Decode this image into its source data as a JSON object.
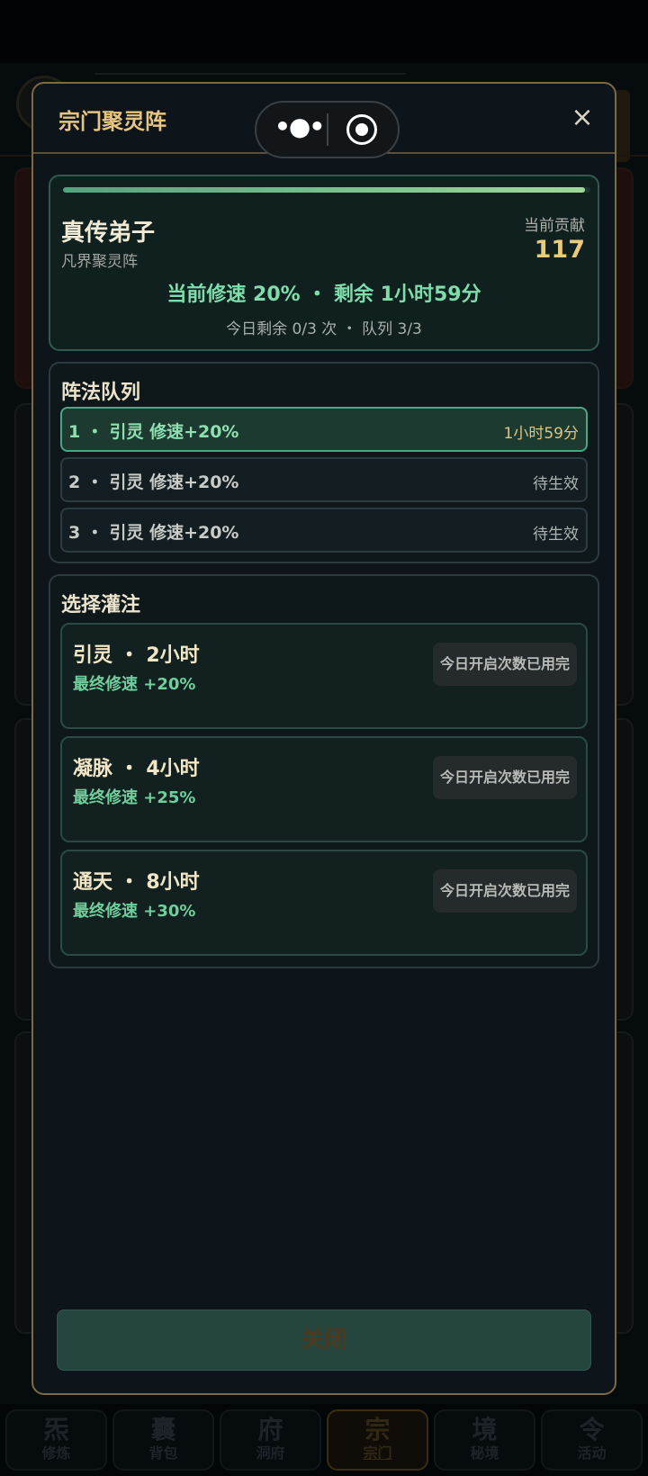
{
  "modal": {
    "title": "宗门聚灵阵",
    "close_icon": "×",
    "status": {
      "progress": 0.99,
      "rank": "真传弟子",
      "array_name": "凡界聚灵阵",
      "contribution_label": "当前贡献",
      "contribution_value": "117",
      "speed_line": "当前修速 20% ・ 剩余 1小时59分",
      "today_line": "今日剩余 0/3 次 ・ 队列 3/3"
    },
    "queue": {
      "title": "阵法队列",
      "rows": [
        {
          "label": "1 ・ 引灵  修速+20%",
          "status": "1小时59分"
        },
        {
          "label": "2 ・ 引灵  修速+20%",
          "status": "待生效"
        },
        {
          "label": "3 ・ 引灵  修速+20%",
          "status": "待生效"
        }
      ]
    },
    "select": {
      "title": "选择灌注",
      "options": [
        {
          "title": "引灵 ・ 2小时",
          "sub": "最终修速 +20%",
          "button": "今日开启次数已用完"
        },
        {
          "title": "凝脉 ・ 4小时",
          "sub": "最终修速 +25%",
          "button": "今日开启次数已用完"
        },
        {
          "title": "通天 ・ 8小时",
          "sub": "最终修速 +30%",
          "button": "今日开启次数已用完"
        }
      ]
    },
    "close_button": "关闭"
  },
  "capsule": {
    "more": "•●•"
  },
  "nav": [
    {
      "glyph": "炁",
      "label": "修炼"
    },
    {
      "glyph": "囊",
      "label": "背包"
    },
    {
      "glyph": "府",
      "label": "洞府"
    },
    {
      "glyph": "宗",
      "label": "宗门"
    },
    {
      "glyph": "境",
      "label": "秘境"
    },
    {
      "glyph": "令",
      "label": "活动"
    }
  ],
  "colors": {
    "accent_gold": "#e6c583",
    "accent_green": "#7fdcab",
    "modal_border": "#7a6a45"
  }
}
